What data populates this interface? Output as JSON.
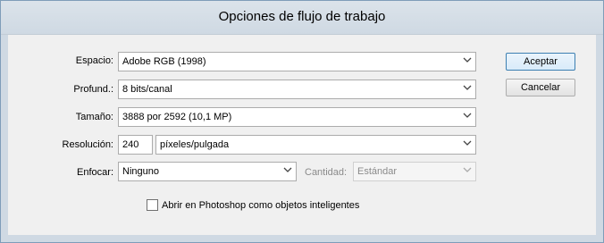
{
  "dialog": {
    "title": "Opciones de flujo de trabajo"
  },
  "fields": {
    "espacio": {
      "label": "Espacio:",
      "value": "Adobe RGB (1998)"
    },
    "profund": {
      "label": "Profund.:",
      "value": "8 bits/canal"
    },
    "tamano": {
      "label": "Tamaño:",
      "value": "3888 por 2592  (10,1 MP)"
    },
    "resolucion": {
      "label": "Resolución:",
      "value": "240",
      "unit": "píxeles/pulgada"
    },
    "enfocar": {
      "label": "Enfocar:",
      "value": "Ninguno"
    },
    "cantidad": {
      "label": "Cantidad:",
      "value": "Estándar"
    }
  },
  "checkbox": {
    "label": "Abrir en Photoshop como objetos inteligentes",
    "checked": false
  },
  "buttons": {
    "accept": "Aceptar",
    "cancel": "Cancelar"
  },
  "colors": {
    "default_button_border": "#3c7fb1",
    "titlebar": "#dbe3ea"
  }
}
